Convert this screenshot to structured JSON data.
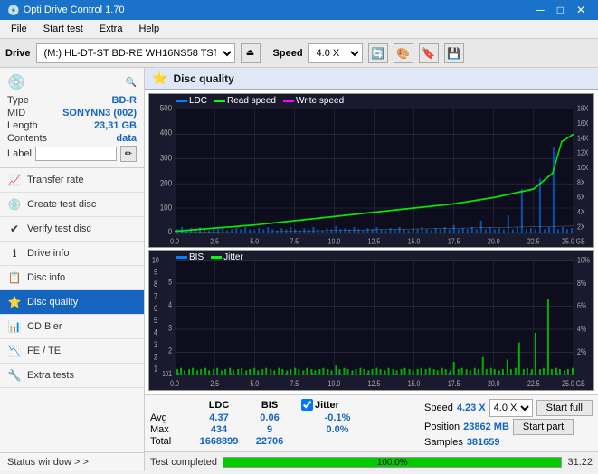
{
  "app": {
    "title": "Opti Drive Control 1.70",
    "icon": "💿"
  },
  "titlebar": {
    "title": "Opti Drive Control 1.70",
    "minimize": "─",
    "maximize": "□",
    "close": "✕"
  },
  "menubar": {
    "items": [
      "File",
      "Start test",
      "Extra",
      "Help"
    ]
  },
  "drivebar": {
    "label": "Drive",
    "drive_value": "(M:)  HL-DT-ST BD-RE  WH16NS58 TST4",
    "speed_label": "Speed",
    "speed_value": "4.0 X"
  },
  "disc": {
    "type_label": "Type",
    "type_value": "BD-R",
    "mid_label": "MID",
    "mid_value": "SONYNN3 (002)",
    "length_label": "Length",
    "length_value": "23,31 GB",
    "contents_label": "Contents",
    "contents_value": "data",
    "label_label": "Label",
    "label_value": ""
  },
  "nav": {
    "items": [
      {
        "id": "transfer-rate",
        "label": "Transfer rate",
        "icon": "📈",
        "active": false
      },
      {
        "id": "create-test-disc",
        "label": "Create test disc",
        "icon": "💿",
        "active": false
      },
      {
        "id": "verify-test-disc",
        "label": "Verify test disc",
        "icon": "✔",
        "active": false
      },
      {
        "id": "drive-info",
        "label": "Drive info",
        "icon": "ℹ",
        "active": false
      },
      {
        "id": "disc-info",
        "label": "Disc info",
        "icon": "📋",
        "active": false
      },
      {
        "id": "disc-quality",
        "label": "Disc quality",
        "icon": "⭐",
        "active": true
      },
      {
        "id": "cd-bler",
        "label": "CD Bler",
        "icon": "📊",
        "active": false
      },
      {
        "id": "fe-te",
        "label": "FE / TE",
        "icon": "📉",
        "active": false
      },
      {
        "id": "extra-tests",
        "label": "Extra tests",
        "icon": "🔧",
        "active": false
      }
    ],
    "status_window": "Status window > >"
  },
  "content": {
    "header": "Disc quality"
  },
  "chart1": {
    "legend": [
      {
        "label": "LDC",
        "color": "#0080ff"
      },
      {
        "label": "Read speed",
        "color": "#00ff00"
      },
      {
        "label": "Write speed",
        "color": "#ff00ff"
      }
    ],
    "y_max": 500,
    "y_right_labels": [
      "18X",
      "16X",
      "14X",
      "12X",
      "10X",
      "8X",
      "6X",
      "4X",
      "2X"
    ],
    "x_labels": [
      "0.0",
      "2.5",
      "5.0",
      "7.5",
      "10.0",
      "12.5",
      "15.0",
      "17.5",
      "20.0",
      "22.5",
      "25.0 GB"
    ]
  },
  "chart2": {
    "legend": [
      {
        "label": "BIS",
        "color": "#0080ff"
      },
      {
        "label": "Jitter",
        "color": "#00ff00"
      }
    ],
    "y_max": 10,
    "y_right_labels": [
      "10%",
      "8%",
      "6%",
      "4%",
      "2%"
    ],
    "x_labels": [
      "0.0",
      "2.5",
      "5.0",
      "7.5",
      "10.0",
      "12.5",
      "15.0",
      "17.5",
      "20.0",
      "22.5",
      "25.0 GB"
    ]
  },
  "stats": {
    "headers": [
      "LDC",
      "BIS",
      "",
      "Jitter",
      "Speed",
      "",
      ""
    ],
    "rows": [
      {
        "label": "Avg",
        "ldc": "4.37",
        "bis": "0.06",
        "jitter": "-0.1%"
      },
      {
        "label": "Max",
        "ldc": "434",
        "bis": "9",
        "jitter": "0.0%"
      },
      {
        "label": "Total",
        "ldc": "1668899",
        "bis": "22706",
        "jitter": ""
      }
    ],
    "speed_label": "Speed",
    "speed_value": "4.23 X",
    "speed_select": "4.0 X",
    "position_label": "Position",
    "position_value": "23862 MB",
    "samples_label": "Samples",
    "samples_value": "381659",
    "start_full": "Start full",
    "start_part": "Start part",
    "jitter_checked": true,
    "jitter_label": "Jitter"
  },
  "progressbar": {
    "value": 100,
    "text": "100.0%",
    "status": "Test completed",
    "time": "31:22"
  }
}
